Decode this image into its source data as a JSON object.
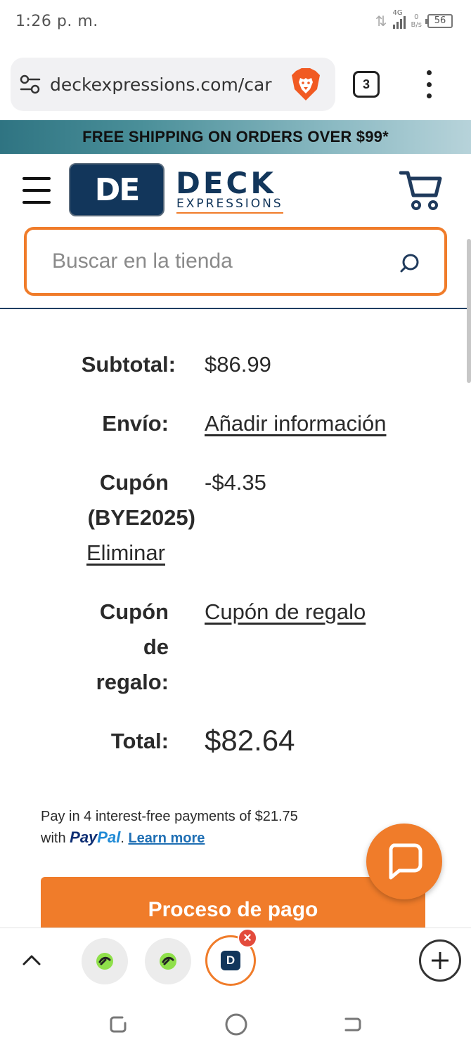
{
  "status": {
    "time": "1:26 p. m.",
    "network": "4G",
    "speed_value": "0",
    "speed_unit": "B/s",
    "battery": "56"
  },
  "browser": {
    "url": "deckexpressions.com/car",
    "tab_count": "3"
  },
  "promo": {
    "text": "FREE SHIPPING ON ORDERS OVER $99*"
  },
  "brand": {
    "logo_mark": "DE",
    "name": "DECK",
    "tagline": "EXPRESSIONS"
  },
  "search": {
    "placeholder": "Buscar en la tienda"
  },
  "totals": {
    "subtotal_label": "Subtotal:",
    "subtotal_value": "$86.99",
    "shipping_label": "Envío:",
    "shipping_value": "Añadir información",
    "coupon_label": "Cupón",
    "coupon_code": "(BYE2025)",
    "coupon_remove": "Eliminar",
    "coupon_value": "-$4.35",
    "gift_label_line1": "Cupón",
    "gift_label_line2": "de",
    "gift_label_line3": "regalo:",
    "gift_value": "Cupón de regalo",
    "total_label": "Total:",
    "total_value": "$82.64"
  },
  "paypal": {
    "line1": "Pay in 4 interest-free payments of $21.75",
    "with": "with",
    "logo_part1": "Pay",
    "logo_part2": "Pal",
    "period": ".",
    "learn_more": "Learn more"
  },
  "checkout": {
    "button_label": "Proceso de pago"
  },
  "tabs": {
    "active_tab_mark": "D",
    "close_mark": "×"
  },
  "colors": {
    "accent": "#f07c2a",
    "brand_navy": "#12365b",
    "paypal_dark": "#0f2f74",
    "paypal_light": "#1f8ad6"
  }
}
